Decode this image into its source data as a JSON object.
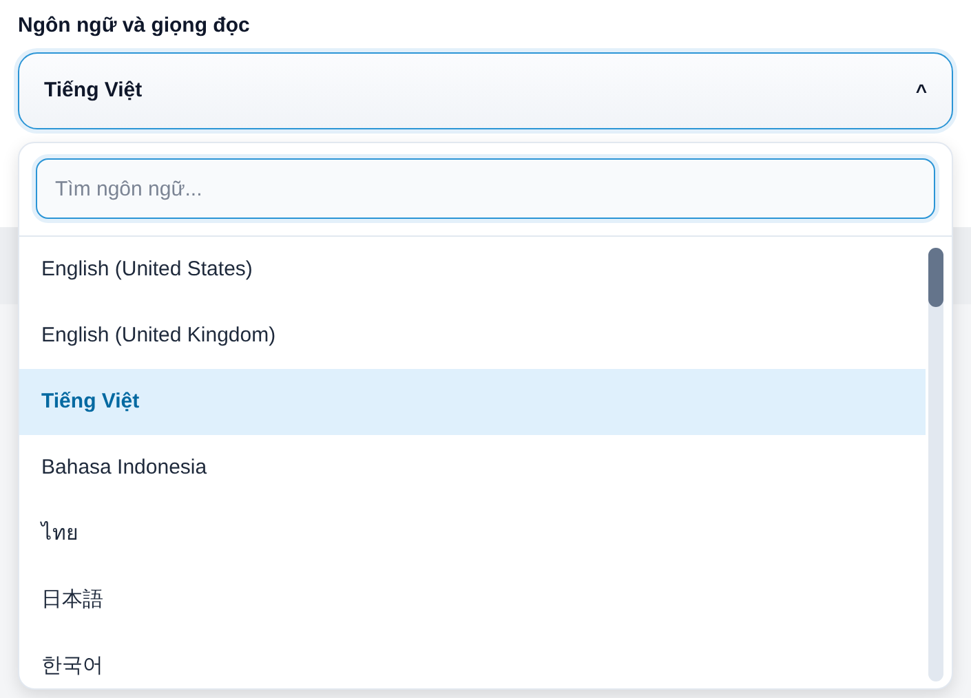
{
  "field_label": "Ngôn ngữ và giọng đọc",
  "select": {
    "value": "Tiếng Việt",
    "caret": "^",
    "expanded": true
  },
  "search": {
    "placeholder": "Tìm ngôn ngữ..."
  },
  "options": [
    {
      "label": "English (United States)",
      "selected": false
    },
    {
      "label": "English (United Kingdom)",
      "selected": false
    },
    {
      "label": "Tiếng Việt",
      "selected": true
    },
    {
      "label": "Bahasa Indonesia",
      "selected": false
    },
    {
      "label": "ไทย",
      "selected": false
    },
    {
      "label": "日本語",
      "selected": false
    },
    {
      "label": "한국어",
      "selected": false
    }
  ]
}
